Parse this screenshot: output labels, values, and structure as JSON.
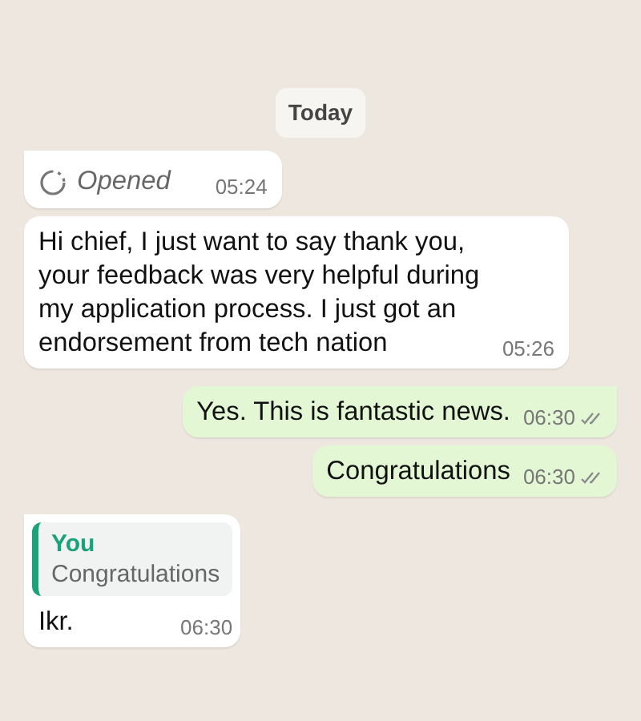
{
  "date_chip": "Today",
  "messages": [
    {
      "kind": "opened",
      "outgoing": false,
      "text": "Opened",
      "time": "05:24"
    },
    {
      "kind": "text",
      "outgoing": false,
      "text": "Hi chief, I just want to say thank you, your feedback was very helpful during my application process. I just got an endorsement from tech nation",
      "time": "05:26"
    },
    {
      "kind": "text",
      "outgoing": true,
      "text": "Yes. This is fantastic news.",
      "time": "06:30",
      "read": false
    },
    {
      "kind": "text",
      "outgoing": true,
      "text": "Congratulations",
      "time": "06:30",
      "read": false
    },
    {
      "kind": "quote",
      "outgoing": false,
      "quote_author": "You",
      "quote_text": "Congratulations",
      "text": "Ikr.",
      "time": "06:30"
    }
  ]
}
